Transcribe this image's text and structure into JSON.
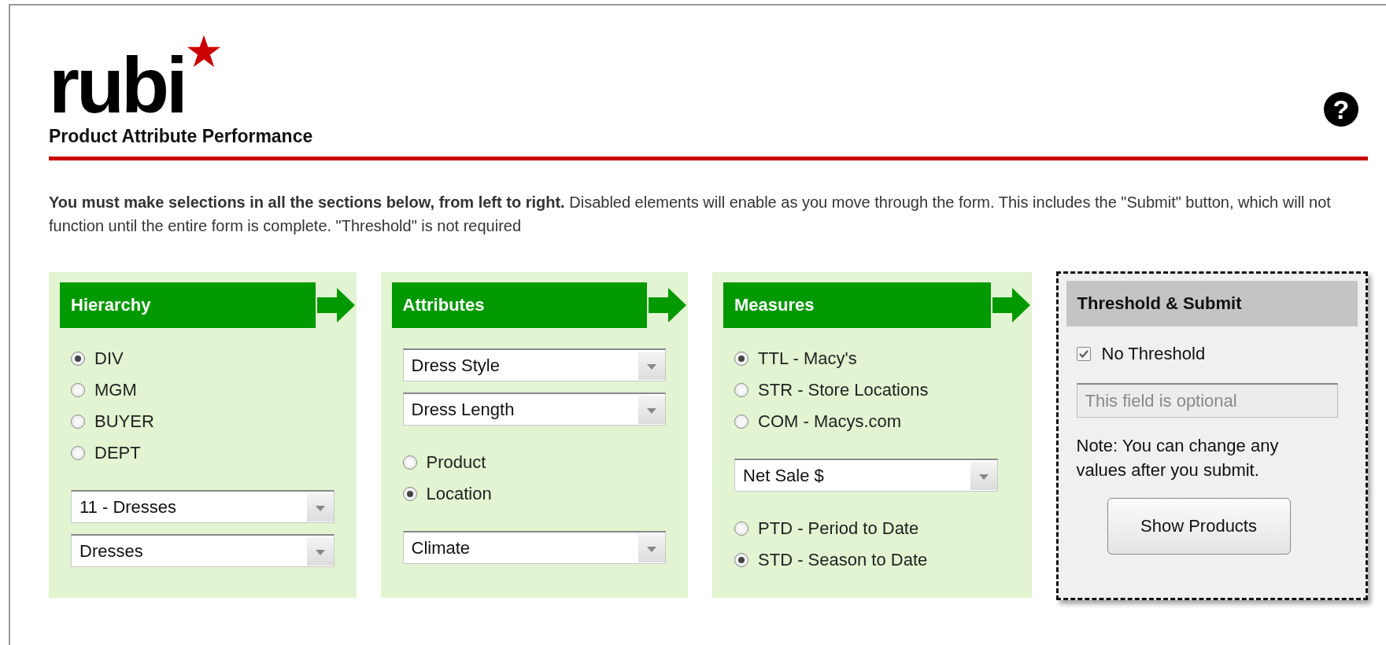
{
  "header": {
    "logo": "rubi",
    "subtitle": "Product Attribute Performance",
    "help": "?"
  },
  "instructions": "**You must make selections in all the sections below, from left to right.** Disabled elements will enable as you move through the form. This includes the \"Submit\" button, which will not function until the entire form is complete. \"Threshold\" is not required",
  "panels": [
    {
      "kind": "step",
      "title": "Hierarchy",
      "groups": [
        {
          "kind": "radios",
          "options": [
            {
              "label": "DIV",
              "selected": true
            },
            {
              "label": "MGM",
              "selected": false
            },
            {
              "label": "BUYER",
              "selected": false
            },
            {
              "label": "DEPT",
              "selected": false
            }
          ]
        },
        {
          "kind": "selects",
          "values": [
            "11 - Dresses",
            "Dresses"
          ]
        }
      ]
    },
    {
      "kind": "step",
      "title": "Attributes",
      "groups": [
        {
          "kind": "selects",
          "values": [
            "Dress Style",
            "Dress Length"
          ]
        },
        {
          "kind": "radios",
          "options": [
            {
              "label": "Product",
              "selected": false
            },
            {
              "label": "Location",
              "selected": true
            }
          ]
        },
        {
          "kind": "selects",
          "values": [
            "Climate"
          ]
        }
      ]
    },
    {
      "kind": "step",
      "title": "Measures",
      "groups": [
        {
          "kind": "radios",
          "options": [
            {
              "label": "TTL - Macy's",
              "selected": true
            },
            {
              "label": "STR - Store Locations",
              "selected": false
            },
            {
              "label": "COM - Macys.com",
              "selected": false
            }
          ]
        },
        {
          "kind": "selects",
          "values": [
            "Net Sale $"
          ]
        },
        {
          "kind": "radios",
          "options": [
            {
              "label": "PTD - Period to Date",
              "selected": false
            },
            {
              "label": "STD - Season to Date",
              "selected": true
            }
          ]
        }
      ]
    },
    {
      "kind": "final",
      "title": "Threshold & Submit",
      "groups": [
        {
          "kind": "checkbox",
          "label": "No Threshold",
          "checked": true
        },
        {
          "kind": "input",
          "placeholder": "This field is optional",
          "disabled": true
        },
        {
          "kind": "note",
          "text": "Note: You can change any values after you submit."
        },
        {
          "kind": "button",
          "label": "Show Products"
        }
      ]
    }
  ]
}
